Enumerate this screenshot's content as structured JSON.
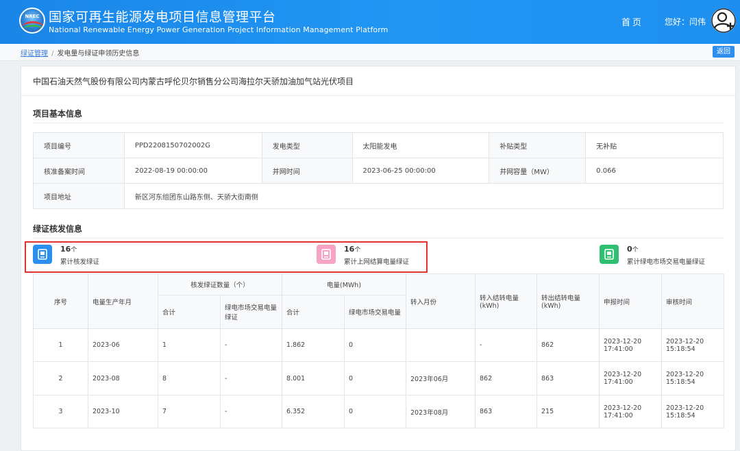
{
  "header": {
    "logo_text": "NREC",
    "title_cn": "国家可再生能源发电项目信息管理平台",
    "title_en": "National Renewable Energy Power Generation Project Information Management Platform",
    "nav_home": "首页",
    "greeting": "您好：闫伟",
    "avatar_icon": "user-add-icon"
  },
  "breadcrumb": {
    "root": "绿证管理",
    "separator": "/",
    "current": "发电量与绿证申领历史信息",
    "back_label": "返回"
  },
  "project": {
    "name": "中国石油天然气股份有限公司内蒙古呼伦贝尔销售分公司海拉尔天骄加油加气站光伏项目"
  },
  "basic_info": {
    "title": "项目基本信息",
    "rows": [
      [
        {
          "label": "项目编号",
          "value": "PPD2208150702002G"
        },
        {
          "label": "发电类型",
          "value": "太阳能发电"
        },
        {
          "label": "补贴类型",
          "value": "无补贴"
        }
      ],
      [
        {
          "label": "核准备案时间",
          "value": "2022-08-19 00:00:00"
        },
        {
          "label": "并网时间",
          "value": "2023-06-25 00:00:00"
        },
        {
          "label": "并网容量（MW）",
          "value": "0.066"
        }
      ]
    ],
    "address": {
      "label": "项目地址",
      "value": "新区河东组团东山路东侧、天骄大街南侧"
    }
  },
  "verify_info": {
    "title": "绿证核发信息",
    "stats": [
      {
        "count": "16",
        "unit": "个",
        "label": "累计核发绿证",
        "color": "#2b8ff0",
        "icon": "document-icon"
      },
      {
        "count": "16",
        "unit": "个",
        "label": "累计上网结算电量绿证",
        "color": "#f6a3c4",
        "icon": "document-icon"
      },
      {
        "count": "0",
        "unit": "个",
        "label": "累计绿电市场交易电量绿证",
        "color": "#2fbf71",
        "icon": "document-icon"
      }
    ]
  },
  "table": {
    "headers": {
      "seq": "序号",
      "month": "电量生产年月",
      "cert_group": "核发绿证数量（个）",
      "cert_total": "合计",
      "cert_market": "绿电市场交易电量绿证",
      "power_group": "电量(MWh)",
      "power_total": "合计",
      "power_market": "绿电市场交易电量",
      "transfer_month": "转入月份",
      "transfer_in": "转入结转电量(kWh)",
      "transfer_out": "转出结转电量(kWh)",
      "report_time": "申报时间",
      "audit_time": "审核时间"
    },
    "rows": [
      {
        "seq": "1",
        "month": "2023-06",
        "cert_total": "1",
        "cert_market": "-",
        "power_total": "1.862",
        "power_market": "0",
        "transfer_month": "",
        "transfer_in": "-",
        "transfer_out": "862",
        "report_date": "2023-12-20",
        "report_clock": "17:41:00",
        "audit_date": "2023-12-20",
        "audit_clock": "15:18:54"
      },
      {
        "seq": "2",
        "month": "2023-08",
        "cert_total": "8",
        "cert_market": "-",
        "power_total": "8.001",
        "power_market": "0",
        "transfer_month": "2023年06月",
        "transfer_in": "862",
        "transfer_out": "863",
        "report_date": "2023-12-20",
        "report_clock": "17:41:00",
        "audit_date": "2023-12-20",
        "audit_clock": "15:18:54"
      },
      {
        "seq": "3",
        "month": "2023-10",
        "cert_total": "7",
        "cert_market": "-",
        "power_total": "6.352",
        "power_market": "0",
        "transfer_month": "2023年08月",
        "transfer_in": "863",
        "transfer_out": "215",
        "report_date": "2023-12-20",
        "report_clock": "17:41:00",
        "audit_date": "2023-12-20",
        "audit_clock": "15:18:54"
      }
    ]
  }
}
